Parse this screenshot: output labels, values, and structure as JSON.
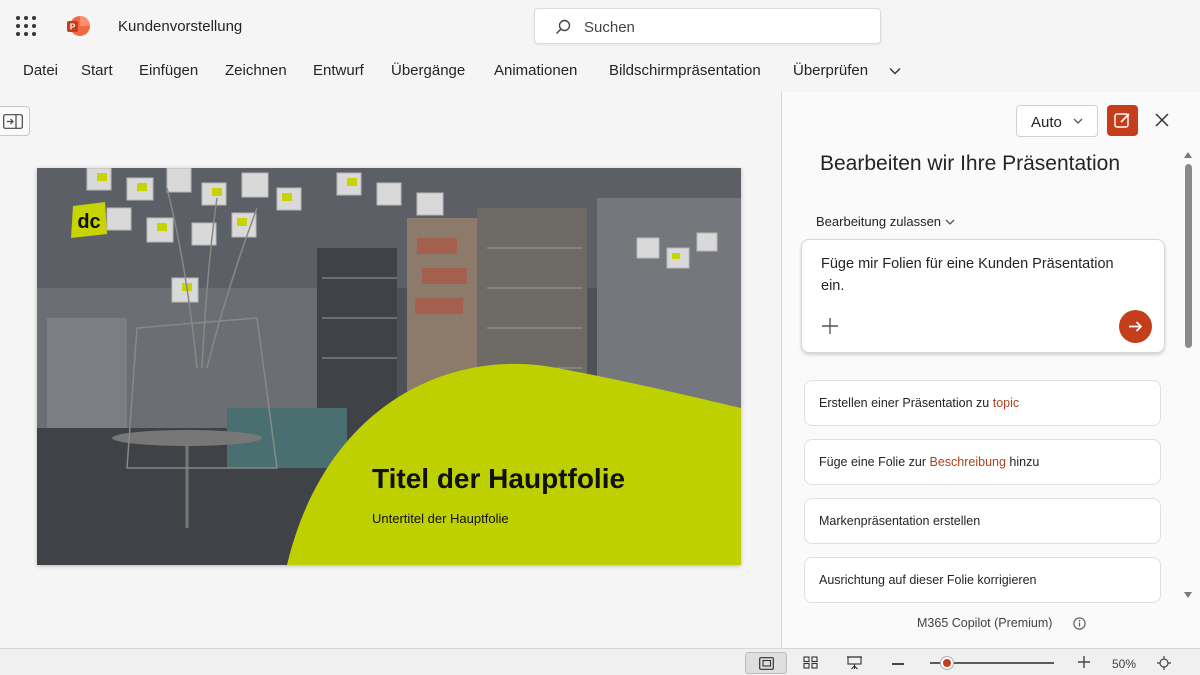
{
  "app": {
    "title": "Kundenvorstellung",
    "brand_color": "#c43e1c",
    "icons": [
      "app-launcher-icon",
      "powerpoint-logo-icon",
      "search-icon"
    ]
  },
  "search": {
    "placeholder": "Suchen"
  },
  "menu": {
    "items": [
      "Datei",
      "Start",
      "Einfügen",
      "Zeichnen",
      "Entwurf",
      "Übergänge",
      "Animationen",
      "Bildschirmpräsentation",
      "Überprüfen"
    ],
    "more_icon": "chevron-down-icon"
  },
  "slide": {
    "title": "Titel der Hauptfolie",
    "subtitle": "Untertitel der Hauptfolie",
    "logo_text": "dc",
    "accent_color": "#bed000"
  },
  "copilot": {
    "mode_label": "Auto",
    "heading": "Bearbeiten wir Ihre Präsentation",
    "edit_permission": "Bearbeitung zulassen",
    "prompt_text": "Füge mir Folien für eine Kunden Präsentation ein.",
    "suggestions": [
      {
        "before": "Erstellen einer Präsentation zu ",
        "highlight": "topic",
        "after": ""
      },
      {
        "before": "Füge eine Folie zur ",
        "highlight": "Beschreibung",
        "after": " hinzu"
      },
      {
        "before": "Markenpräsentation erstellen",
        "highlight": "",
        "after": ""
      },
      {
        "before": "Ausrichtung auf dieser Folie korrigieren",
        "highlight": "",
        "after": ""
      }
    ],
    "footer": "M365 Copilot (Premium)"
  },
  "statusbar": {
    "zoom_label": "50%",
    "zoom_level": 0.1
  }
}
